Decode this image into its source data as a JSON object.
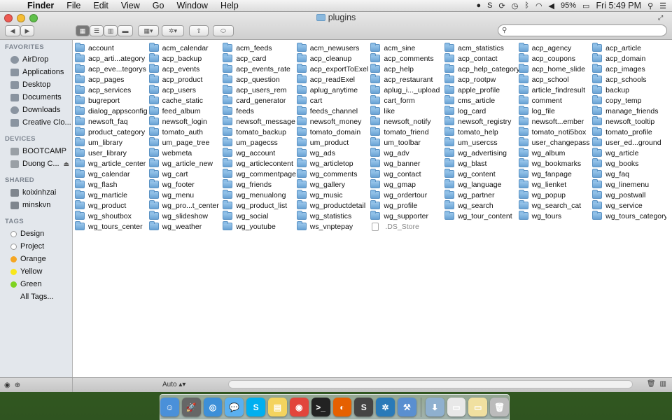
{
  "menubar": {
    "app_name": "Finder",
    "items": [
      "File",
      "Edit",
      "View",
      "Go",
      "Window",
      "Help"
    ],
    "battery": "95%",
    "clock": "Fri 5:49 PM"
  },
  "window": {
    "title": "plugins",
    "search_placeholder": ""
  },
  "sidebar": {
    "favorites_header": "FAVORITES",
    "favorites": [
      "AirDrop",
      "Applications",
      "Desktop",
      "Documents",
      "Downloads",
      "Creative Clo..."
    ],
    "devices_header": "DEVICES",
    "devices": [
      "BOOTCAMP",
      "Duong C..."
    ],
    "shared_header": "SHARED",
    "shared": [
      "koixinhzai",
      "minskvn"
    ],
    "tags_header": "TAGS",
    "tags": [
      {
        "label": "Design",
        "color": "#ffffff"
      },
      {
        "label": "Project",
        "color": "#ffffff"
      },
      {
        "label": "Orange",
        "color": "#f5a623"
      },
      {
        "label": "Yellow",
        "color": "#f8e71c"
      },
      {
        "label": "Green",
        "color": "#7ed321"
      },
      {
        "label": "All Tags...",
        "color": ""
      }
    ]
  },
  "files": [
    "account",
    "acp_arti...ategory",
    "acp_eve...tegorys",
    "acp_pages",
    "acp_services",
    "bugreport",
    "dialog_appsconfig",
    "newsoft_faq",
    "product_category",
    "um_library",
    "user_library",
    "wg_article_center",
    "wg_calendar",
    "wg_flash",
    "wg_marticle",
    "wg_product",
    "wg_shoutbox",
    "wg_tours_center",
    "acm_calendar",
    "acp_backup",
    "acp_events",
    "acp_product",
    "acp_users",
    "cache_static",
    "feed_album",
    "newsoft_login",
    "tomato_auth",
    "um_page_tree",
    "webmeta",
    "wg_article_new",
    "wg_cart",
    "wg_footer",
    "wg_menu",
    "wg_pro...t_center",
    "wg_slideshow",
    "wg_weather",
    "acm_feeds",
    "acp_card",
    "acp_events_rate",
    "acp_question",
    "acp_users_rem",
    "card_generator",
    "feeds",
    "newsoft_message",
    "tomato_backup",
    "um_pagecss",
    "wg_account",
    "wg_articlecontent",
    "wg_commentpage",
    "wg_friends",
    "wg_menualong",
    "wg_product_list",
    "wg_social",
    "wg_youtube",
    "acm_newusers",
    "acp_cleanup",
    "acp_exportToExel",
    "acp_readExel",
    "aplug_anytime",
    "cart",
    "feeds_channel",
    "newsoft_money",
    "tomato_domain",
    "um_product",
    "wg_ads",
    "wg_articletop",
    "wg_comments",
    "wg_gallery",
    "wg_music",
    "wg_productdetail",
    "wg_statistics",
    "ws_vnptepay",
    "acm_sine",
    "acp_comments",
    "acp_help",
    "acp_restaurant",
    "aplug_i..._upload",
    "cart_form",
    "like",
    "newsoft_notify",
    "tomato_friend",
    "um_toolbar",
    "wg_adv",
    "wg_banner",
    "wg_contact",
    "wg_gmap",
    "wg_ordertour",
    "wg_profile",
    "wg_supporter",
    ".DS_Store",
    "acm_statistics",
    "acp_contact",
    "acp_help_category",
    "acp_rootpw",
    "apple_profile",
    "cms_article",
    "log_card",
    "newsoft_registry",
    "tomato_help",
    "um_usercss",
    "wg_advertising",
    "wg_blast",
    "wg_content",
    "wg_language",
    "wg_partner",
    "wg_search",
    "wg_tour_content",
    "",
    "acp_agency",
    "acp_coupons",
    "acp_home_slide",
    "acp_school",
    "article_findresult",
    "comment",
    "log_file",
    "newsoft...ember",
    "tomato_noti5box",
    "user_changepass",
    "wg_album",
    "wg_bookmarks",
    "wg_fanpage",
    "wg_lienket",
    "wg_popup",
    "wg_search_cat",
    "wg_tours",
    "",
    "acp_article",
    "acp_domain",
    "acp_images",
    "acp_schools",
    "backup",
    "copy_temp",
    "manage_friends",
    "newsoft_tooltip",
    "tomato_profile",
    "user_ed...ground",
    "wg_article",
    "wg_books",
    "wg_faq",
    "wg_linemenu",
    "wg_postwall",
    "wg_service",
    "wg_tours_category",
    ""
  ],
  "statusbar": {
    "zoom": "Auto"
  },
  "dock": [
    {
      "name": "finder-icon",
      "color": "#4a90d9",
      "glyph": "☺"
    },
    {
      "name": "launchpad-icon",
      "color": "#666666",
      "glyph": "🚀"
    },
    {
      "name": "safari-icon",
      "color": "#3d8fd8",
      "glyph": "◎"
    },
    {
      "name": "messages-icon",
      "color": "#5ab0f0",
      "glyph": "💬"
    },
    {
      "name": "skype-icon",
      "color": "#00aff0",
      "glyph": "S"
    },
    {
      "name": "stickies-icon",
      "color": "#f4d35e",
      "glyph": "▤"
    },
    {
      "name": "chrome-icon",
      "color": "#e2453c",
      "glyph": "◉"
    },
    {
      "name": "terminal-icon",
      "color": "#222222",
      "glyph": ">_"
    },
    {
      "name": "firefox-icon",
      "color": "#e66000",
      "glyph": "◐"
    },
    {
      "name": "sublime-icon",
      "color": "#444444",
      "glyph": "S"
    },
    {
      "name": "network-icon",
      "color": "#2a7ab8",
      "glyph": "✲"
    },
    {
      "name": "xcode-icon",
      "color": "#5a8fd0",
      "glyph": "⚒"
    },
    {
      "name": "downloads-icon",
      "color": "#8fb0cf",
      "glyph": "⬇"
    },
    {
      "name": "documents-icon",
      "color": "#e8e8e8",
      "glyph": "▭"
    },
    {
      "name": "stack-icon",
      "color": "#f0e0a0",
      "glyph": "▭"
    },
    {
      "name": "trash-icon",
      "color": "#bbbbbb",
      "glyph": "🗑"
    }
  ]
}
